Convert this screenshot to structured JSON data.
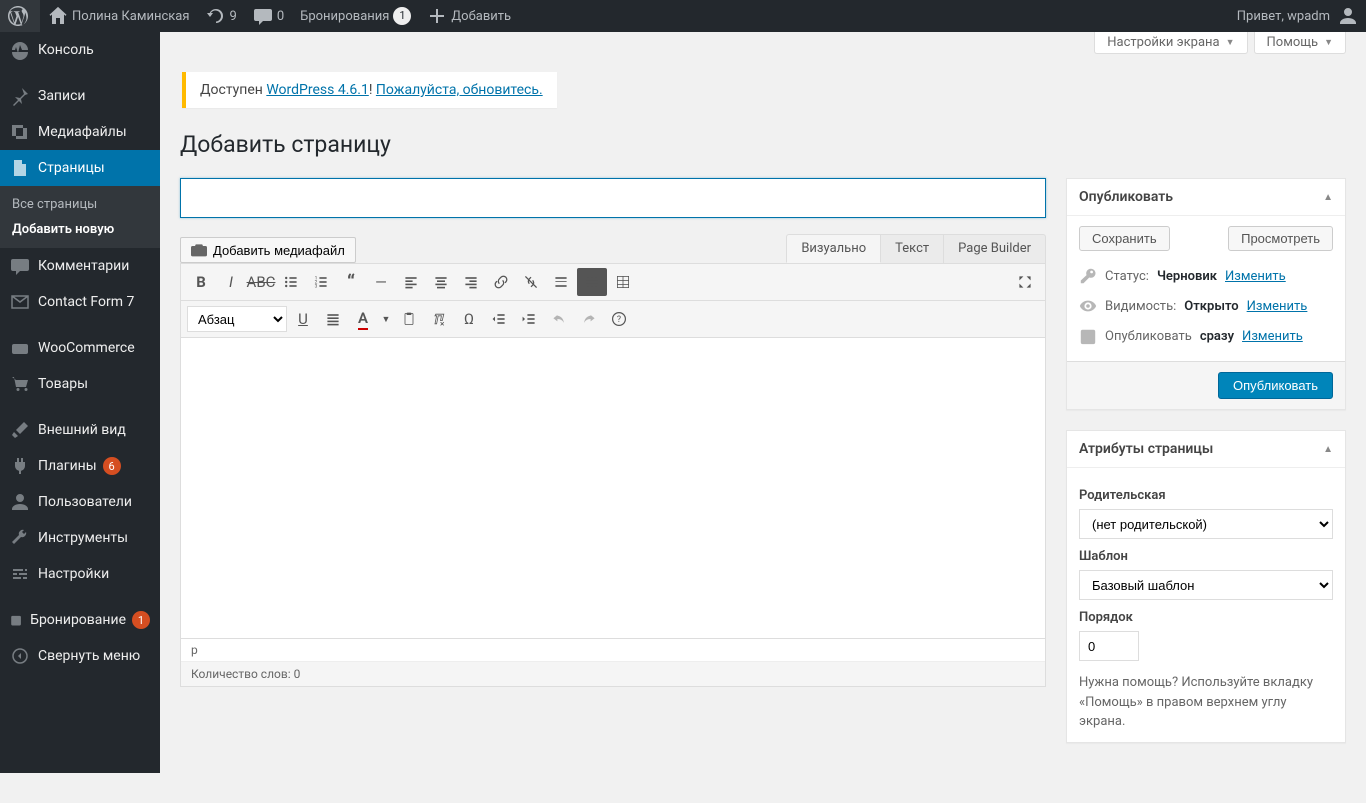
{
  "adminbar": {
    "site_name": "Полина Каминская",
    "updates_count": "9",
    "comments_count": "0",
    "bookings_label": "Бронирования",
    "bookings_count": "1",
    "add_new": "Добавить",
    "greeting": "Привет, wpadm"
  },
  "menu": {
    "dashboard": "Консоль",
    "posts": "Записи",
    "media": "Медиафайлы",
    "pages": "Страницы",
    "pages_sub_all": "Все страницы",
    "pages_sub_new": "Добавить новую",
    "comments": "Комментарии",
    "cf7": "Contact Form 7",
    "woo": "WooCommerce",
    "products": "Товары",
    "appearance": "Внешний вид",
    "plugins": "Плагины",
    "plugins_badge": "6",
    "users": "Пользователи",
    "tools": "Инструменты",
    "settings": "Настройки",
    "booking": "Бронирование",
    "booking_badge": "1",
    "collapse": "Свернуть меню"
  },
  "screen_meta": {
    "options": "Настройки экрана",
    "help": "Помощь"
  },
  "update_nag": {
    "prefix": "Доступен ",
    "link1": "WordPress 4.6.1",
    "mid": "! ",
    "link2": "Пожалуйста, обновитесь.",
    "suffix": ""
  },
  "page": {
    "heading": "Добавить страницу",
    "title_value": "",
    "title_placeholder": ""
  },
  "editor": {
    "media_button": "Добавить медиафайл",
    "tab_visual": "Визуально",
    "tab_text": "Текст",
    "tab_pagebuilder": "Page Builder",
    "format_select": "Абзац",
    "status_path": "p",
    "word_count": "Количество слов: 0"
  },
  "publish_box": {
    "title": "Опубликовать",
    "save": "Сохранить",
    "preview": "Просмотреть",
    "status_label": "Статус:",
    "status_value": "Черновик",
    "visibility_label": "Видимость:",
    "visibility_value": "Открыто",
    "schedule_label": "Опубликовать",
    "schedule_value": "сразу",
    "edit": "Изменить",
    "publish": "Опубликовать"
  },
  "attributes_box": {
    "title": "Атрибуты страницы",
    "parent_label": "Родительская",
    "parent_value": "(нет родительской)",
    "template_label": "Шаблон",
    "template_value": "Базовый шаблон",
    "order_label": "Порядок",
    "order_value": "0",
    "help": "Нужна помощь? Используйте вкладку «Помощь» в правом верхнем углу экрана."
  }
}
